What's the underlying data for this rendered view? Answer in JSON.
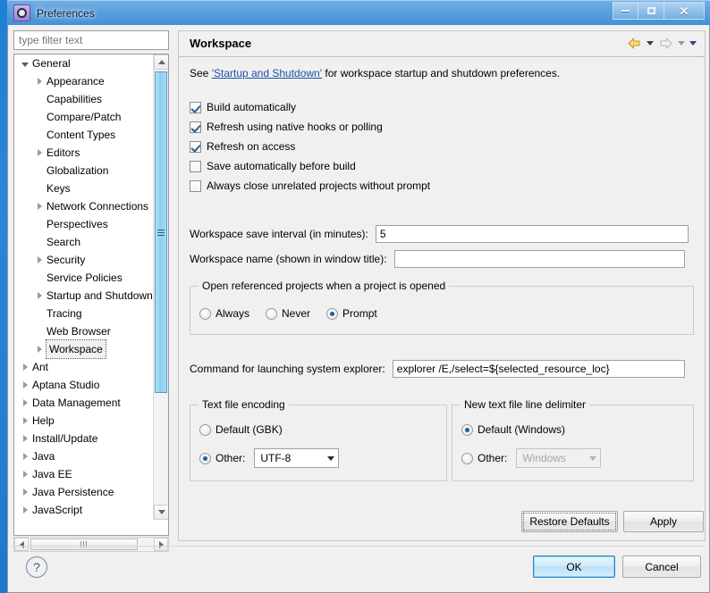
{
  "window": {
    "title": "Preferences",
    "icon": "preferences-gear-icon",
    "controls": {
      "minimize": "minimize-icon",
      "maximize": "maximize-icon",
      "close": "close-icon"
    }
  },
  "sidebar": {
    "filter_placeholder": "type filter text",
    "filter_value": "",
    "items": [
      {
        "label": "General",
        "indent": 0,
        "state": "expanded",
        "selected": false
      },
      {
        "label": "Appearance",
        "indent": 1,
        "state": "collapsed",
        "selected": false
      },
      {
        "label": "Capabilities",
        "indent": 1,
        "state": "leaf",
        "selected": false
      },
      {
        "label": "Compare/Patch",
        "indent": 1,
        "state": "leaf",
        "selected": false
      },
      {
        "label": "Content Types",
        "indent": 1,
        "state": "leaf",
        "selected": false
      },
      {
        "label": "Editors",
        "indent": 1,
        "state": "collapsed",
        "selected": false
      },
      {
        "label": "Globalization",
        "indent": 1,
        "state": "leaf",
        "selected": false
      },
      {
        "label": "Keys",
        "indent": 1,
        "state": "leaf",
        "selected": false
      },
      {
        "label": "Network Connections",
        "indent": 1,
        "state": "collapsed",
        "selected": false
      },
      {
        "label": "Perspectives",
        "indent": 1,
        "state": "leaf",
        "selected": false
      },
      {
        "label": "Search",
        "indent": 1,
        "state": "leaf",
        "selected": false
      },
      {
        "label": "Security",
        "indent": 1,
        "state": "collapsed",
        "selected": false
      },
      {
        "label": "Service Policies",
        "indent": 1,
        "state": "leaf",
        "selected": false
      },
      {
        "label": "Startup and Shutdown",
        "indent": 1,
        "state": "collapsed",
        "selected": false
      },
      {
        "label": "Tracing",
        "indent": 1,
        "state": "leaf",
        "selected": false
      },
      {
        "label": "Web Browser",
        "indent": 1,
        "state": "leaf",
        "selected": false
      },
      {
        "label": "Workspace",
        "indent": 1,
        "state": "collapsed",
        "selected": true
      },
      {
        "label": "Ant",
        "indent": 0,
        "state": "collapsed",
        "selected": false
      },
      {
        "label": "Aptana Studio",
        "indent": 0,
        "state": "collapsed",
        "selected": false
      },
      {
        "label": "Data Management",
        "indent": 0,
        "state": "collapsed",
        "selected": false
      },
      {
        "label": "Help",
        "indent": 0,
        "state": "collapsed",
        "selected": false
      },
      {
        "label": "Install/Update",
        "indent": 0,
        "state": "collapsed",
        "selected": false
      },
      {
        "label": "Java",
        "indent": 0,
        "state": "collapsed",
        "selected": false
      },
      {
        "label": "Java EE",
        "indent": 0,
        "state": "collapsed",
        "selected": false
      },
      {
        "label": "Java Persistence",
        "indent": 0,
        "state": "collapsed",
        "selected": false
      },
      {
        "label": "JavaScript",
        "indent": 0,
        "state": "collapsed",
        "selected": false
      }
    ]
  },
  "page": {
    "title": "Workspace",
    "description_before": "See ",
    "description_link": "'Startup and Shutdown'",
    "description_after": " for workspace startup and shutdown preferences.",
    "nav": {
      "back": "back-arrow-icon",
      "back_menu": "back-dropdown-icon",
      "forward": "forward-arrow-icon",
      "forward_menu": "forward-dropdown-icon",
      "menu": "view-menu-icon"
    },
    "checkboxes": [
      {
        "label": "Build automatically",
        "checked": true
      },
      {
        "label": "Refresh using native hooks or polling",
        "checked": true
      },
      {
        "label": "Refresh on access",
        "checked": true
      },
      {
        "label": "Save automatically before build",
        "checked": false
      },
      {
        "label": "Always close unrelated projects without prompt",
        "checked": false
      }
    ],
    "save_interval": {
      "label": "Workspace save interval (in minutes):",
      "value": "5"
    },
    "workspace_name": {
      "label": "Workspace name (shown in window title):",
      "value": ""
    },
    "open_referenced": {
      "title": "Open referenced projects when a project is opened",
      "options": [
        {
          "label": "Always",
          "selected": false
        },
        {
          "label": "Never",
          "selected": false
        },
        {
          "label": "Prompt",
          "selected": true
        }
      ]
    },
    "system_explorer": {
      "label": "Command for launching system explorer:",
      "value": "explorer /E,/select=${selected_resource_loc}"
    },
    "text_file_encoding": {
      "title": "Text file encoding",
      "default_option": {
        "label": "Default (GBK)",
        "selected": false
      },
      "other_option": {
        "label": "Other:",
        "selected": true
      },
      "other_value": "UTF-8",
      "other_disabled": false
    },
    "line_delimiter": {
      "title": "New text file line delimiter",
      "default_option": {
        "label": "Default (Windows)",
        "selected": true
      },
      "other_option": {
        "label": "Other:",
        "selected": false
      },
      "other_value": "Windows",
      "other_disabled": true
    },
    "restore_defaults_label": "Restore Defaults",
    "apply_label": "Apply"
  },
  "footer": {
    "help_icon": "help-question-icon",
    "ok_label": "OK",
    "cancel_label": "Cancel"
  }
}
